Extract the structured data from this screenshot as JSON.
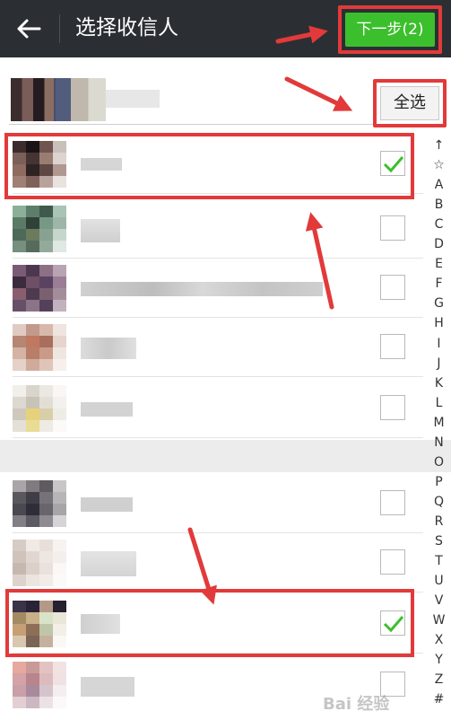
{
  "header": {
    "back_icon": "arrow-left-icon",
    "title": "选择收信人",
    "next_button": "下一步(2)"
  },
  "toolbar": {
    "select_all": "全选"
  },
  "contacts": [
    {
      "checked": true
    },
    {
      "checked": false
    },
    {
      "checked": false
    },
    {
      "checked": false
    },
    {
      "checked": false
    },
    {
      "checked": false
    },
    {
      "checked": false
    },
    {
      "checked": true
    },
    {
      "checked": false
    }
  ],
  "index_bar": [
    "↑",
    "☆",
    "A",
    "B",
    "C",
    "D",
    "E",
    "F",
    "G",
    "H",
    "I",
    "J",
    "K",
    "L",
    "M",
    "N",
    "O",
    "P",
    "Q",
    "R",
    "S",
    "T",
    "U",
    "V",
    "W",
    "X",
    "Y",
    "Z",
    "#"
  ],
  "watermark": {
    "icon": "baidu-jingyan-logo",
    "text": "Bai 经验"
  },
  "colors": {
    "topbar": "#2b2f33",
    "next_button": "#3cbf2d",
    "checkmark": "#3cbf2d",
    "annotation": "#e23a3a"
  }
}
